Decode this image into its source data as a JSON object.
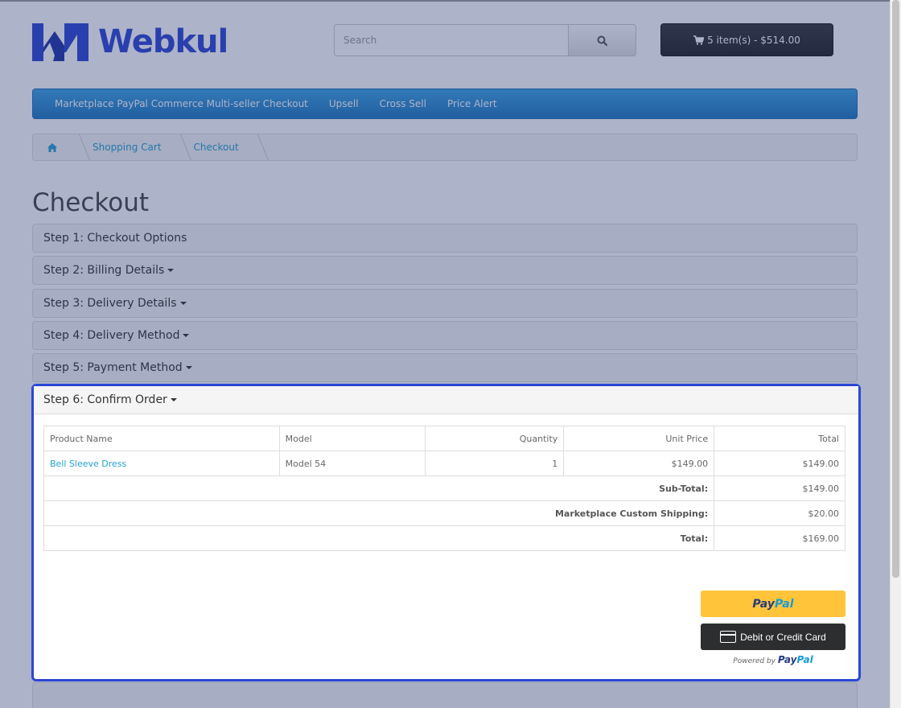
{
  "header": {
    "logo_text": "Webkul",
    "search_placeholder": "Search",
    "cart_label": "5 item(s) - $514.00"
  },
  "menu": {
    "items": [
      "Marketplace PayPal Commerce Multi-seller Checkout",
      "Upsell",
      "Cross Sell",
      "Price Alert"
    ]
  },
  "breadcrumb": {
    "items": [
      "Shopping Cart",
      "Checkout"
    ]
  },
  "page_title": "Checkout",
  "steps": [
    {
      "label": "Step 1: Checkout Options",
      "has_caret": false
    },
    {
      "label": "Step 2: Billing Details",
      "has_caret": true
    },
    {
      "label": "Step 3: Delivery Details",
      "has_caret": true
    },
    {
      "label": "Step 4: Delivery Method",
      "has_caret": true
    },
    {
      "label": "Step 5: Payment Method",
      "has_caret": true
    },
    {
      "label": "Step 6: Confirm Order",
      "has_caret": true
    }
  ],
  "order_table": {
    "headers": [
      "Product Name",
      "Model",
      "Quantity",
      "Unit Price",
      "Total"
    ],
    "rows": [
      {
        "product": "Bell Sleeve Dress",
        "model": "Model 54",
        "quantity": "1",
        "unit_price": "$149.00",
        "total": "$149.00"
      }
    ],
    "totals": [
      {
        "label": "Sub-Total:",
        "value": "$149.00"
      },
      {
        "label": "Marketplace Custom Shipping:",
        "value": "$20.00"
      },
      {
        "label": "Total:",
        "value": "$169.00"
      }
    ]
  },
  "paypal": {
    "pay": "Pay",
    "pal": "Pal",
    "card_label": "Debit or Credit Card",
    "powered_by": "Powered by",
    "powered_pay": "Pay",
    "powered_pal": "Pal"
  },
  "colors": {
    "brand_blue": "#2d45d6",
    "menu_blue": "#2a8fd4",
    "highlight": "#2b47d6",
    "paypal_yellow": "#ffc439"
  }
}
